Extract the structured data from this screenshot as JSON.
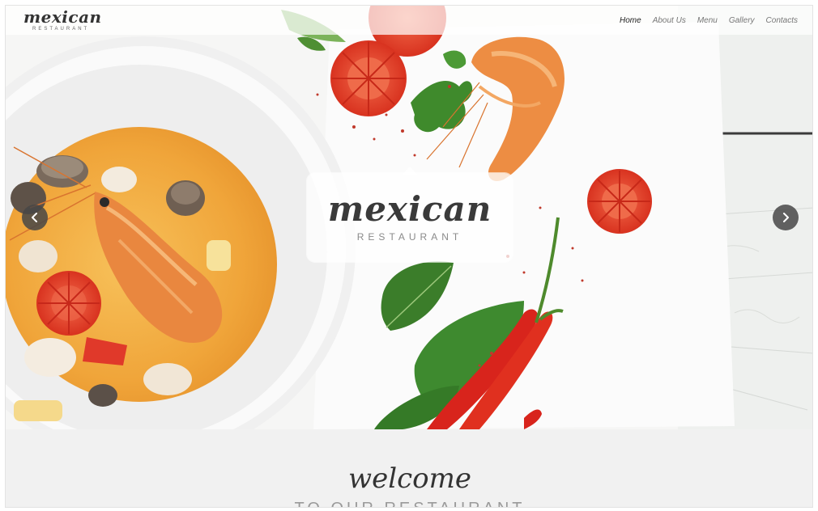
{
  "header": {
    "brand_name": "mexican",
    "brand_sub": "RESTAURANT",
    "nav": [
      {
        "label": "Home",
        "active": true
      },
      {
        "label": "About Us",
        "active": false
      },
      {
        "label": "Menu",
        "active": false
      },
      {
        "label": "Gallery",
        "active": false
      },
      {
        "label": "Contacts",
        "active": false
      }
    ]
  },
  "hero": {
    "logo_title": "mexican",
    "logo_sub": "RESTAURANT",
    "prev_icon": "chevron-left-icon",
    "next_icon": "chevron-right-icon"
  },
  "welcome": {
    "title": "welcome",
    "subtitle": "TO OUR RESTAURANT"
  },
  "colors": {
    "soup": "#f2a93b",
    "tomato": "#e2402c",
    "chili": "#d8241c",
    "leaf": "#3f8a2c",
    "shrimp": "#ec8a3e",
    "arrow_bg": "#464646"
  }
}
